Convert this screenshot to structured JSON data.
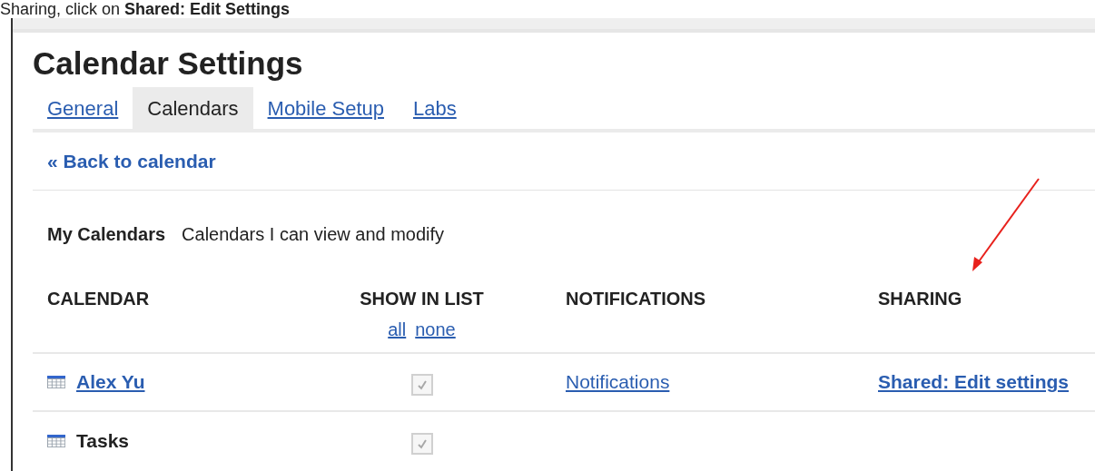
{
  "caption": "Sharing, click on **Shared: Edit Settings**",
  "title": "Calendar Settings",
  "tabs": [
    {
      "label": "General",
      "selected": false
    },
    {
      "label": "Calendars",
      "selected": true
    },
    {
      "label": "Mobile Setup",
      "selected": false
    },
    {
      "label": "Labs",
      "selected": false
    }
  ],
  "back_link": "« Back to calendar",
  "section": {
    "title": "My Calendars",
    "description": "Calendars I can view and modify"
  },
  "columns": [
    "CALENDAR",
    "SHOW IN LIST",
    "NOTIFICATIONS",
    "SHARING"
  ],
  "show_links": [
    "all",
    "none"
  ],
  "rows": [
    {
      "name": "Alex Yu",
      "link": true,
      "show": {
        "checked": true,
        "disabled": true
      },
      "notifications": "Notifications",
      "sharing": "Shared: Edit settings"
    },
    {
      "name": "Tasks",
      "link": false,
      "show": {
        "checked": true,
        "disabled": true
      }
    }
  ]
}
